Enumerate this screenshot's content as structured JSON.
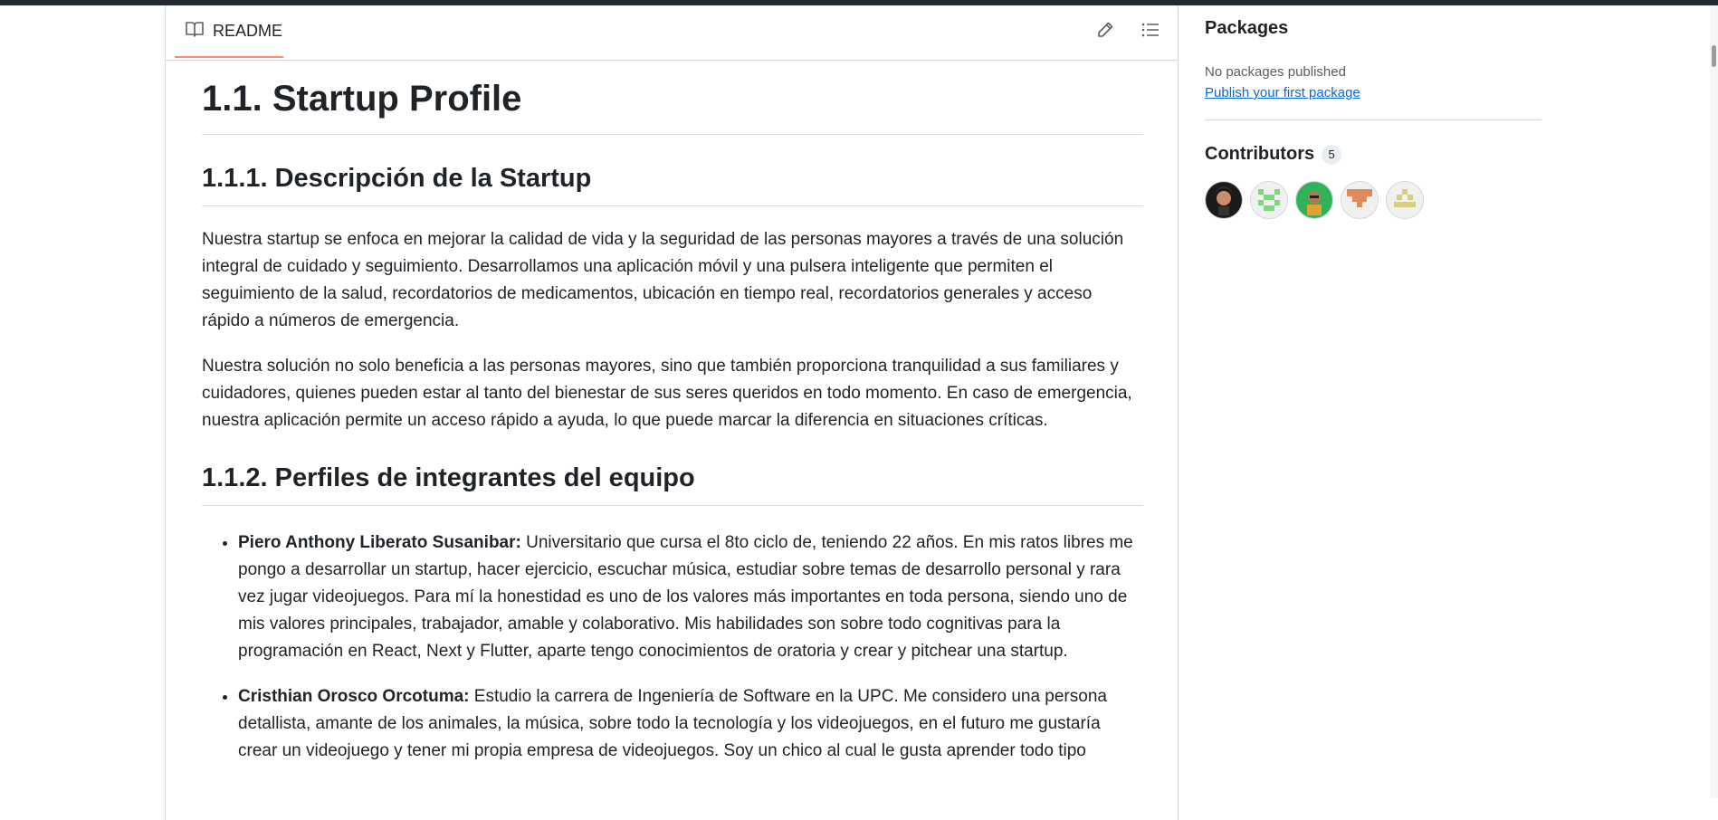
{
  "readme": {
    "tab_label": "README",
    "edit_icon": "pencil-icon",
    "toc_icon": "list-unordered-icon",
    "book_icon": "book-icon"
  },
  "article": {
    "h1": "1.1. Startup Profile",
    "h2_desc": "1.1.1. Descripción de la Startup",
    "para1": "Nuestra startup se enfoca en mejorar la calidad de vida y la seguridad de las personas mayores a través de una solución integral de cuidado y seguimiento. Desarrollamos una aplicación móvil y una pulsera inteligente que permiten el seguimiento de la salud, recordatorios de medicamentos, ubicación en tiempo real, recordatorios generales y acceso rápido a números de emergencia.",
    "para2": "Nuestra solución no solo beneficia a las personas mayores, sino que también proporciona tranquilidad a sus familiares y cuidadores, quienes pueden estar al tanto del bienestar de sus seres queridos en todo momento. En caso de emergencia, nuestra aplicación permite un acceso rápido a ayuda, lo que puede marcar la diferencia en situaciones críticas.",
    "h2_team": "1.1.2. Perfiles de integrantes del equipo",
    "team": [
      {
        "name": "Piero Anthony Liberato Susanibar:",
        "text": " Universitario que cursa el 8to ciclo de, teniendo 22 años. En mis ratos libres me pongo a desarrollar un startup, hacer ejercicio, escuchar música, estudiar sobre temas de desarrollo personal y rara vez jugar videojuegos. Para mí la honestidad es uno de los valores más importantes en toda persona, siendo uno de mis valores principales, trabajador, amable y colaborativo. Mis habilidades son sobre todo cognitivas para la programación en React, Next y Flutter, aparte tengo conocimientos de oratoria y crear y pitchear una startup."
      },
      {
        "name": "Cristhian Orosco Orcotuma:",
        "text": " Estudio la carrera de Ingeniería de Software en la UPC. Me considero una persona detallista, amante de los animales, la música, sobre todo la tecnología y los videojuegos, en el futuro me gustaría crear un videojuego y tener mi propia empresa de videojuegos. Soy un chico al cual le gusta aprender todo tipo"
      }
    ]
  },
  "sidebar": {
    "packages_title": "Packages",
    "packages_empty": "No packages published",
    "packages_link": "Publish your first package",
    "contributors_title": "Contributors",
    "contributors_count": "5",
    "avatar_colors": [
      "#1b1b1b",
      "#7ed67e",
      "#2fb35a",
      "#e08a5a",
      "#d8cf7a"
    ]
  }
}
